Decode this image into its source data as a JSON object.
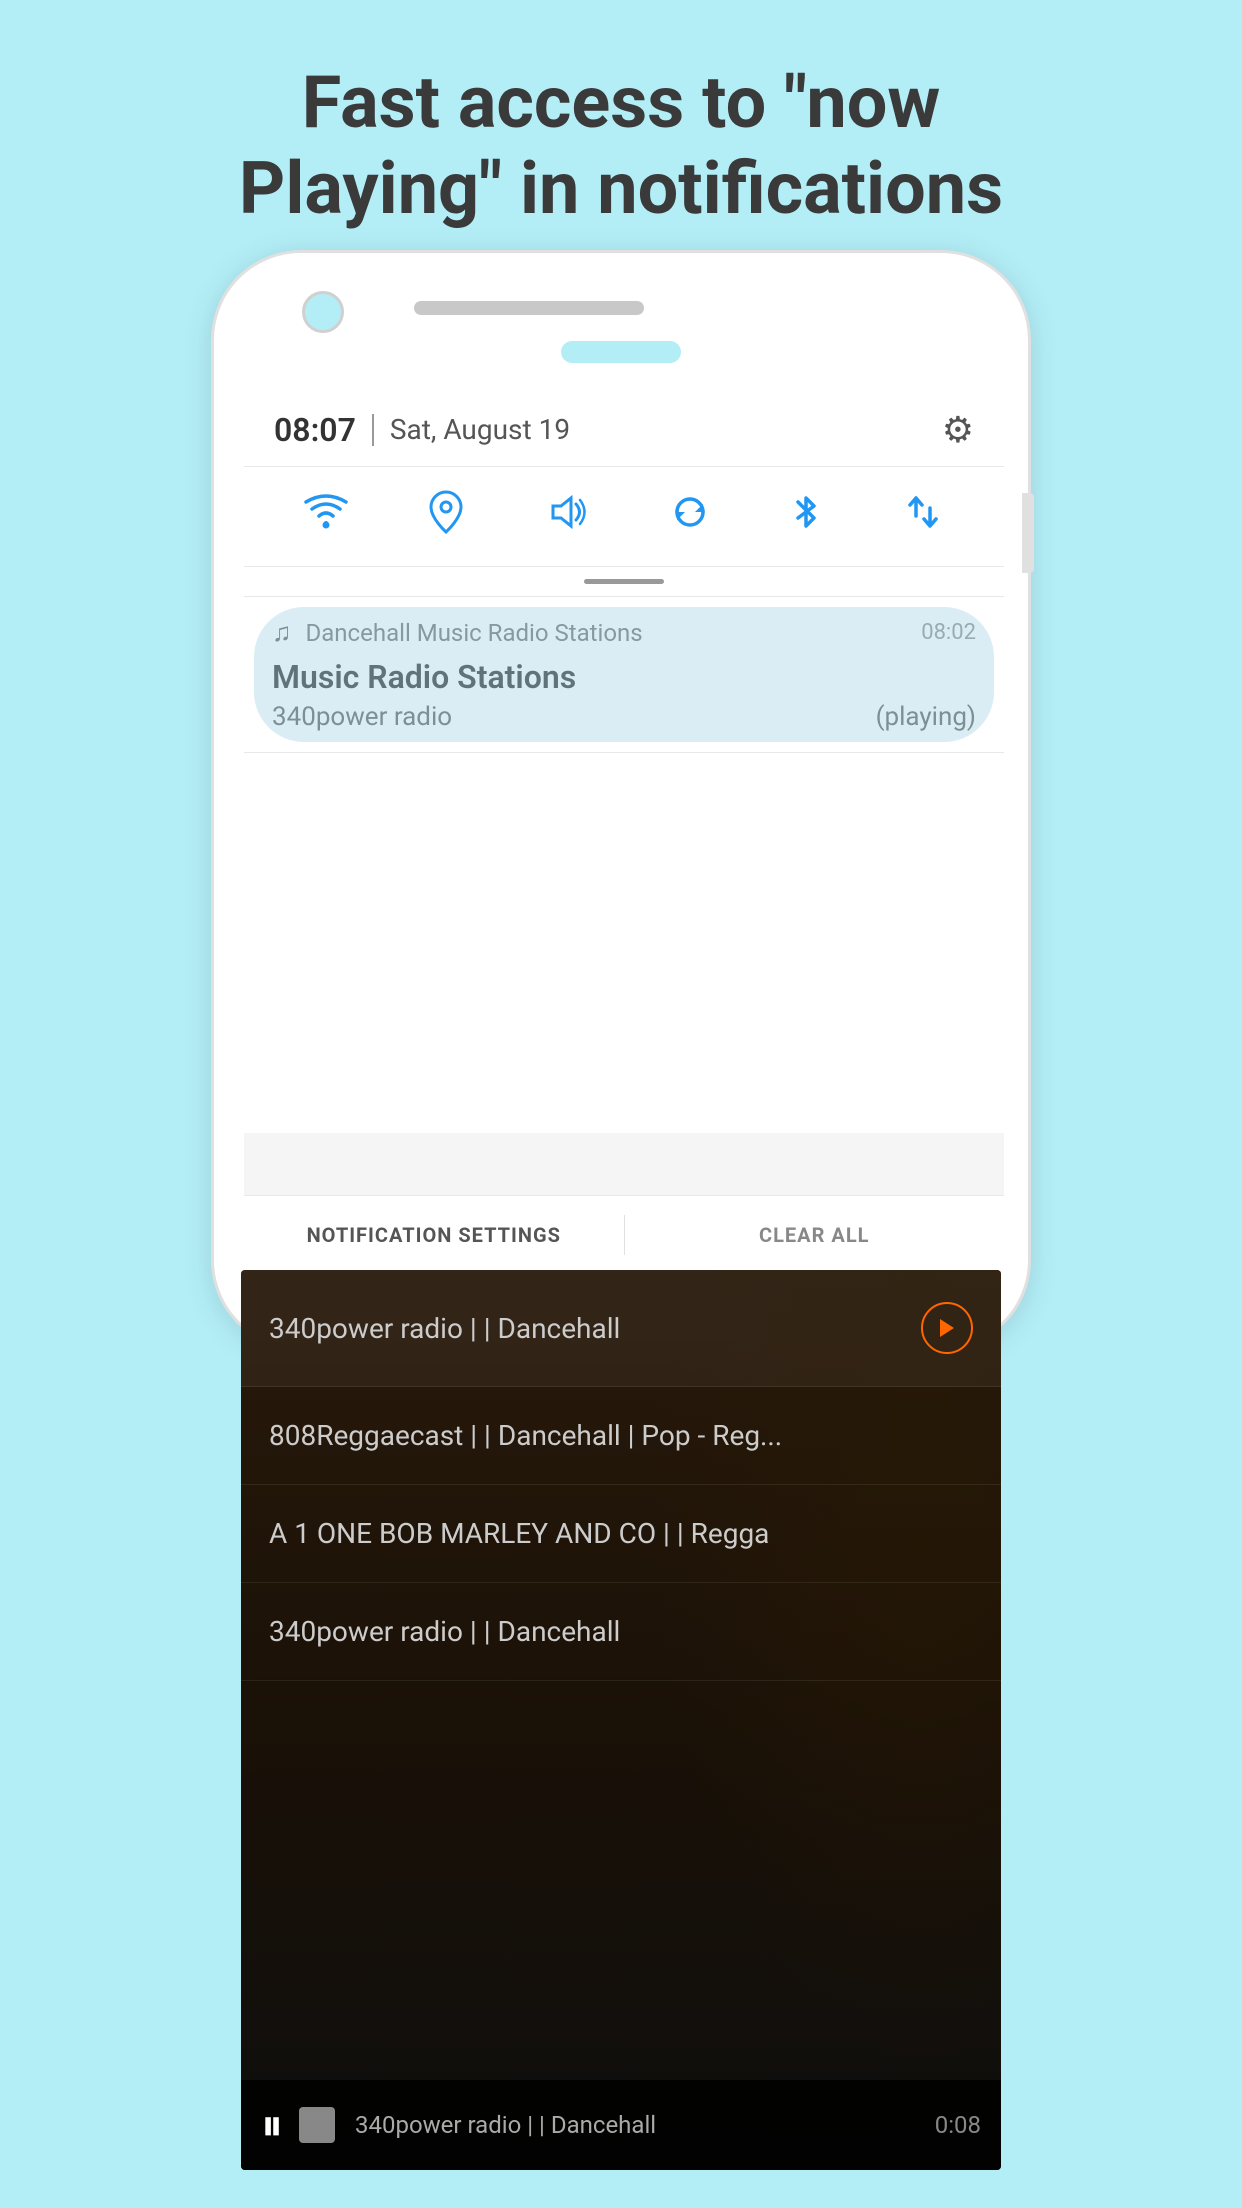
{
  "headline": {
    "line1": "Fast access to \"now",
    "line2": "Playing\" in notifications"
  },
  "status_bar": {
    "time": "08:07",
    "divider": "|",
    "date": "Sat, August 19",
    "gear_icon": "⚙"
  },
  "quick_settings": {
    "icons": [
      "wifi",
      "location",
      "volume",
      "sync",
      "bluetooth",
      "arrows"
    ]
  },
  "notification": {
    "app_icon": "♫",
    "app_name": "Dancehall Music Radio Stations",
    "time": "08:02",
    "title": "Music Radio Stations",
    "station": "340power radio",
    "status": "(playing)"
  },
  "bottom_bar": {
    "settings_label": "NOTIFICATION SETTINGS",
    "clear_label": "CLEAR ALL"
  },
  "station_list": [
    {
      "name": "340power radio | | Dancehall",
      "has_play": true
    },
    {
      "name": "808Reggaecast | | Dancehall | Pop - Reg...",
      "has_play": false
    },
    {
      "name": "A 1 ONE BOB MARLEY AND CO | | Regga",
      "has_play": false
    },
    {
      "name": "340power radio | | Dancehall",
      "has_play": false
    }
  ],
  "player_bar": {
    "station": "340power radio | | Dancehall",
    "time": "0:08"
  }
}
